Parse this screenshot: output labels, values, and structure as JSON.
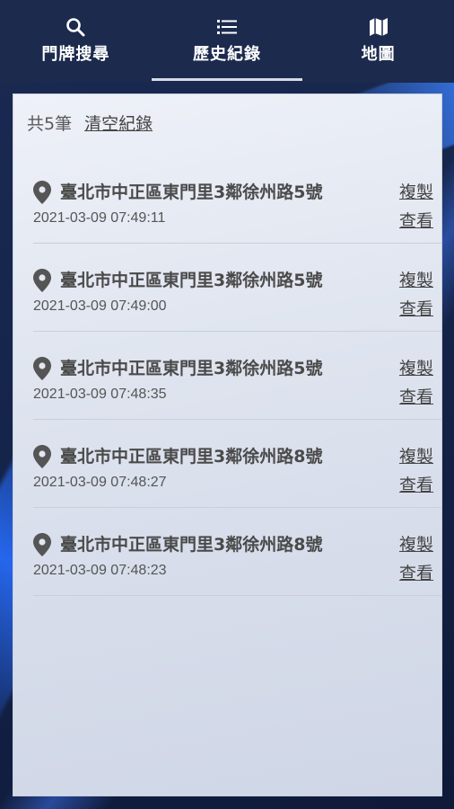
{
  "tabs": [
    {
      "label": "門牌搜尋",
      "icon": "search-icon",
      "active": false
    },
    {
      "label": "歷史紀錄",
      "icon": "list-icon",
      "active": true
    },
    {
      "label": "地圖",
      "icon": "map-icon",
      "active": false
    }
  ],
  "header": {
    "count_text": "共5筆",
    "clear_label": "清空紀錄"
  },
  "records": [
    {
      "address": "臺北市中正區東門里3鄰徐州路5號",
      "time": "2021-03-09 07:49:11",
      "copy_label": "複製",
      "view_label": "查看"
    },
    {
      "address": "臺北市中正區東門里3鄰徐州路5號",
      "time": "2021-03-09 07:49:00",
      "copy_label": "複製",
      "view_label": "查看"
    },
    {
      "address": "臺北市中正區東門里3鄰徐州路5號",
      "time": "2021-03-09 07:48:35",
      "copy_label": "複製",
      "view_label": "查看"
    },
    {
      "address": "臺北市中正區東門里3鄰徐州路8號",
      "time": "2021-03-09 07:48:27",
      "copy_label": "複製",
      "view_label": "查看"
    },
    {
      "address": "臺北市中正區東門里3鄰徐州路8號",
      "time": "2021-03-09 07:48:23",
      "copy_label": "複製",
      "view_label": "查看"
    }
  ],
  "colors": {
    "tabbar": "#1c2a4d",
    "panel": "#e2e7f1",
    "text": "#4a4a4a"
  }
}
